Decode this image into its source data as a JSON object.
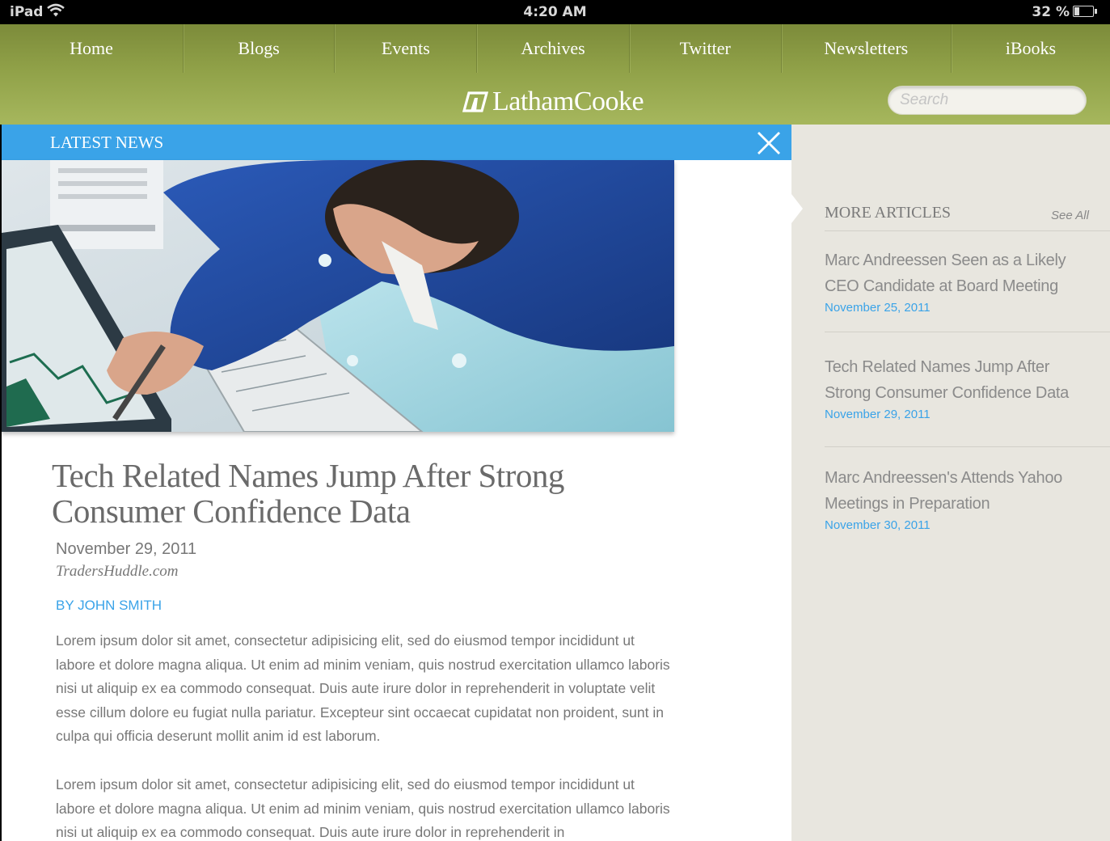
{
  "status_bar": {
    "device": "iPad",
    "time": "4:20 AM",
    "battery_percent": "32 %",
    "battery_level": 0.32
  },
  "nav": {
    "items": [
      "Home",
      "Blogs",
      "Events",
      "Archives",
      "Twitter",
      "Newsletters",
      "iBooks"
    ]
  },
  "brand": {
    "name": "LathamCooke",
    "name_part1": "Latham",
    "name_part2": "Cooke"
  },
  "search": {
    "placeholder": "Search"
  },
  "latest_news": {
    "label": "LATEST NEWS"
  },
  "article": {
    "title": "Tech Related Names Jump After Strong Consumer Confidence Data",
    "date": "November 29, 2011",
    "source": "TradersHuddle.com",
    "byline": "BY JOHN SMITH",
    "paragraphs": [
      "Lorem ipsum dolor sit amet, consectetur adipisicing elit, sed do eiusmod tempor incididunt ut labore et dolore magna aliqua. Ut enim ad minim veniam, quis nostrud exercitation ullamco laboris nisi ut aliquip ex ea commodo consequat. Duis aute irure dolor in reprehenderit in voluptate velit esse cillum dolore eu fugiat nulla pariatur. Excepteur sint occaecat cupidatat non proident, sunt in culpa qui officia deserunt mollit anim id est laborum.",
      "Lorem ipsum dolor sit amet, consectetur adipisicing elit, sed do eiusmod tempor incididunt ut labore et dolore magna aliqua. Ut enim ad minim veniam, quis nostrud exercitation ullamco laboris nisi ut aliquip ex ea commodo consequat. Duis aute irure dolor in reprehenderit in"
    ]
  },
  "sidebar": {
    "title": "MORE ARTICLES",
    "see_all": "See All",
    "articles": [
      {
        "title": "Marc Andreessen Seen as a Likely CEO Candidate at Board Meeting",
        "date": "November 25, 2011"
      },
      {
        "title": "Tech Related Names Jump After Strong Consumer Confidence Data",
        "date": "November 29, 2011"
      },
      {
        "title": "Marc Andreessen's Attends Yahoo Meetings in Preparation",
        "date": "November 30, 2011"
      }
    ]
  },
  "colors": {
    "accent_blue": "#3aa3e8",
    "header_green": "#90a148",
    "sidebar_bg": "#e8e6df"
  },
  "icons": {
    "close": "close-icon",
    "wifi": "wifi-icon",
    "battery": "battery-icon",
    "logo": "latham-cooke-logo-icon"
  }
}
